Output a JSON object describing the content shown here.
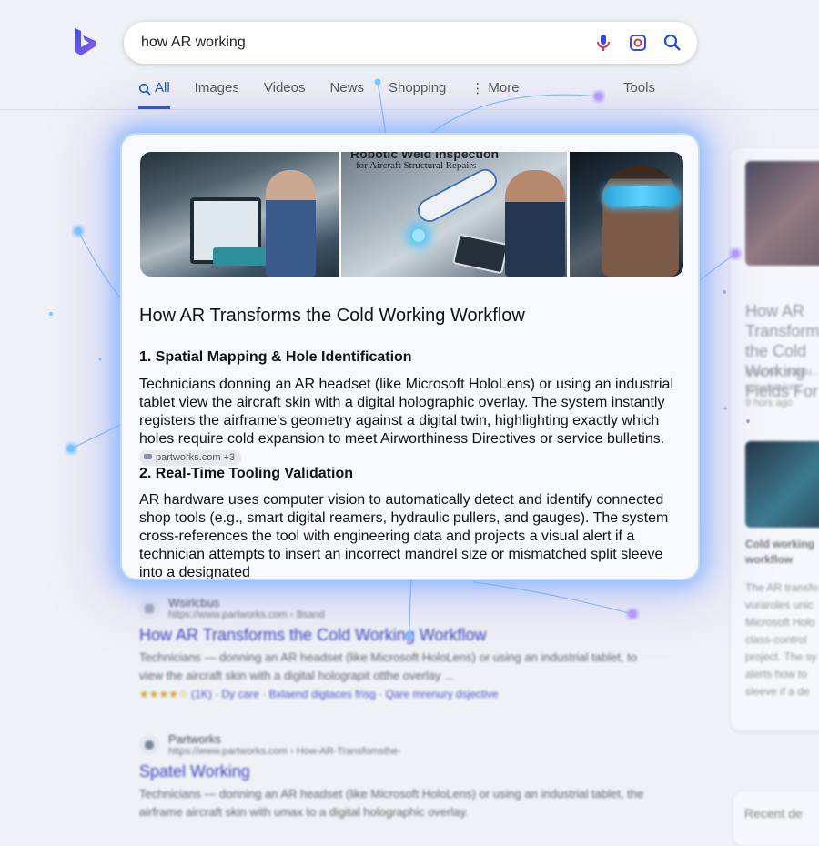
{
  "search": {
    "query": "how AR working"
  },
  "nav": {
    "tabs": [
      "All",
      "Images",
      "Videos",
      "News",
      "Shopping",
      "More"
    ],
    "tools": "Tools"
  },
  "card": {
    "images": [
      {
        "caption_line1": "",
        "caption_line2": ""
      },
      {
        "caption_line1": "Robotic Weld Inspection",
        "caption_line2": "for Aircraft Structural Repairs"
      },
      {
        "caption_line1": "",
        "caption_line2": ""
      }
    ],
    "title": "How AR Transforms the Cold Working Workflow",
    "sections": [
      {
        "heading": "1. Spatial Mapping & Hole Identification",
        "text": "Technicians donning an AR headset (like Microsoft HoloLens) or using an industrial tablet view the aircraft skin with a digital holographic overlay. The system instantly registers the airframe's geometry against a digital twin, highlighting exactly which holes require cold expansion to meet Airworthiness Directives or service bulletins.",
        "citation": "partworks.com +3"
      },
      {
        "heading": "2. Real-Time Tooling Validation",
        "text": "AR hardware uses computer vision to automatically detect and identify connected shop tools (e.g., smart digital reamers, hydraulic pullers, and gauges). The system cross-references the tool with engineering data and projects a visual alert if a technician attempts to insert an incorrect mandrel size or mismatched split sleeve into a designated"
      }
    ]
  },
  "results": [
    {
      "site": "Wsirlcbus",
      "url": "https://www.partworks.com › Bsand",
      "title": "How AR Transforms the Cold Working Workflow",
      "snippet": "Technicians — donning an AR headset (like Microsoft HoloLens) or using an industrial tablet, to view the aircraft skin with a digital holograpit otthe overlay ...",
      "stars": "★★★★☆",
      "meta": "(1K) · Dy care · Bxlaend digtaces frisg · Qare mrenury dsjective"
    },
    {
      "site": "Partworks",
      "url": "https://www.partworks.com › How-AR-Transfomsthe-",
      "title": "Spatel Working",
      "snippet": "Technicians — donning an AR headset (like Microsoft HoloLens) or using an industrial tablet, the airframe aircraft skin with umax to a digital holographic overlay."
    }
  ],
  "sidebar": {
    "title": "How AR Transforms the Cold Working Fields For ...",
    "sub": "How AR subdu...\nsuoeiatelotu\n9 hors ago",
    "card_heading": "Cold working workflow",
    "card_text": "The AR transfo vuraroles unic Microsoft Holo class-control project. The sy alerts how to sleeve if a de"
  },
  "sidebar2": {
    "title": "Recent de"
  },
  "colors": {
    "accent": "#174ae4",
    "link": "#2a2fb8",
    "glow": "#6eafff"
  }
}
